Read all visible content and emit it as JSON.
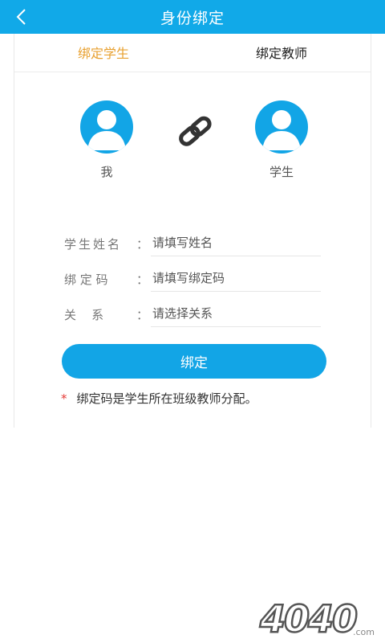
{
  "header": {
    "title": "身份绑定"
  },
  "tabs": [
    {
      "label": "绑定学生",
      "active": true
    },
    {
      "label": "绑定教师",
      "active": false
    }
  ],
  "binding": {
    "self_label": "我",
    "student_label": "学生"
  },
  "form": {
    "fields": [
      {
        "label": "学生姓名",
        "colon": "：",
        "placeholder": "请填写姓名"
      },
      {
        "label": "绑 定 码",
        "colon": "：",
        "placeholder": "请填写绑定码"
      },
      {
        "label": "关    系",
        "colon": "：",
        "placeholder": "请选择关系"
      }
    ],
    "submit_label": "绑定"
  },
  "note": {
    "star": "*",
    "text": "绑定码是学生所在班级教师分配。"
  },
  "watermark": {
    "text": "4040",
    "suffix": ".com"
  },
  "colors": {
    "primary": "#11a9e8",
    "tab_active": "#e8a02f",
    "required_star": "#e53935"
  }
}
